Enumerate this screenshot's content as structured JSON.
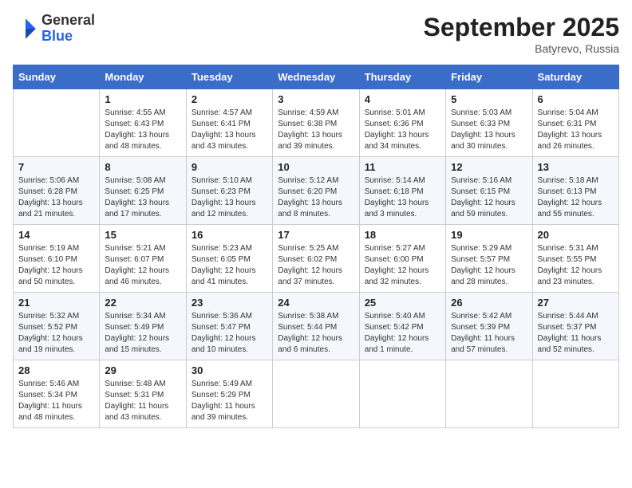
{
  "logo": {
    "general": "General",
    "blue": "Blue"
  },
  "title": "September 2025",
  "location": "Batyrevo, Russia",
  "days_of_week": [
    "Sunday",
    "Monday",
    "Tuesday",
    "Wednesday",
    "Thursday",
    "Friday",
    "Saturday"
  ],
  "weeks": [
    [
      {
        "day": "",
        "info": ""
      },
      {
        "day": "1",
        "info": "Sunrise: 4:55 AM\nSunset: 6:43 PM\nDaylight: 13 hours\nand 48 minutes."
      },
      {
        "day": "2",
        "info": "Sunrise: 4:57 AM\nSunset: 6:41 PM\nDaylight: 13 hours\nand 43 minutes."
      },
      {
        "day": "3",
        "info": "Sunrise: 4:59 AM\nSunset: 6:38 PM\nDaylight: 13 hours\nand 39 minutes."
      },
      {
        "day": "4",
        "info": "Sunrise: 5:01 AM\nSunset: 6:36 PM\nDaylight: 13 hours\nand 34 minutes."
      },
      {
        "day": "5",
        "info": "Sunrise: 5:03 AM\nSunset: 6:33 PM\nDaylight: 13 hours\nand 30 minutes."
      },
      {
        "day": "6",
        "info": "Sunrise: 5:04 AM\nSunset: 6:31 PM\nDaylight: 13 hours\nand 26 minutes."
      }
    ],
    [
      {
        "day": "7",
        "info": "Sunrise: 5:06 AM\nSunset: 6:28 PM\nDaylight: 13 hours\nand 21 minutes."
      },
      {
        "day": "8",
        "info": "Sunrise: 5:08 AM\nSunset: 6:25 PM\nDaylight: 13 hours\nand 17 minutes."
      },
      {
        "day": "9",
        "info": "Sunrise: 5:10 AM\nSunset: 6:23 PM\nDaylight: 13 hours\nand 12 minutes."
      },
      {
        "day": "10",
        "info": "Sunrise: 5:12 AM\nSunset: 6:20 PM\nDaylight: 13 hours\nand 8 minutes."
      },
      {
        "day": "11",
        "info": "Sunrise: 5:14 AM\nSunset: 6:18 PM\nDaylight: 13 hours\nand 3 minutes."
      },
      {
        "day": "12",
        "info": "Sunrise: 5:16 AM\nSunset: 6:15 PM\nDaylight: 12 hours\nand 59 minutes."
      },
      {
        "day": "13",
        "info": "Sunrise: 5:18 AM\nSunset: 6:13 PM\nDaylight: 12 hours\nand 55 minutes."
      }
    ],
    [
      {
        "day": "14",
        "info": "Sunrise: 5:19 AM\nSunset: 6:10 PM\nDaylight: 12 hours\nand 50 minutes."
      },
      {
        "day": "15",
        "info": "Sunrise: 5:21 AM\nSunset: 6:07 PM\nDaylight: 12 hours\nand 46 minutes."
      },
      {
        "day": "16",
        "info": "Sunrise: 5:23 AM\nSunset: 6:05 PM\nDaylight: 12 hours\nand 41 minutes."
      },
      {
        "day": "17",
        "info": "Sunrise: 5:25 AM\nSunset: 6:02 PM\nDaylight: 12 hours\nand 37 minutes."
      },
      {
        "day": "18",
        "info": "Sunrise: 5:27 AM\nSunset: 6:00 PM\nDaylight: 12 hours\nand 32 minutes."
      },
      {
        "day": "19",
        "info": "Sunrise: 5:29 AM\nSunset: 5:57 PM\nDaylight: 12 hours\nand 28 minutes."
      },
      {
        "day": "20",
        "info": "Sunrise: 5:31 AM\nSunset: 5:55 PM\nDaylight: 12 hours\nand 23 minutes."
      }
    ],
    [
      {
        "day": "21",
        "info": "Sunrise: 5:32 AM\nSunset: 5:52 PM\nDaylight: 12 hours\nand 19 minutes."
      },
      {
        "day": "22",
        "info": "Sunrise: 5:34 AM\nSunset: 5:49 PM\nDaylight: 12 hours\nand 15 minutes."
      },
      {
        "day": "23",
        "info": "Sunrise: 5:36 AM\nSunset: 5:47 PM\nDaylight: 12 hours\nand 10 minutes."
      },
      {
        "day": "24",
        "info": "Sunrise: 5:38 AM\nSunset: 5:44 PM\nDaylight: 12 hours\nand 6 minutes."
      },
      {
        "day": "25",
        "info": "Sunrise: 5:40 AM\nSunset: 5:42 PM\nDaylight: 12 hours\nand 1 minute."
      },
      {
        "day": "26",
        "info": "Sunrise: 5:42 AM\nSunset: 5:39 PM\nDaylight: 11 hours\nand 57 minutes."
      },
      {
        "day": "27",
        "info": "Sunrise: 5:44 AM\nSunset: 5:37 PM\nDaylight: 11 hours\nand 52 minutes."
      }
    ],
    [
      {
        "day": "28",
        "info": "Sunrise: 5:46 AM\nSunset: 5:34 PM\nDaylight: 11 hours\nand 48 minutes."
      },
      {
        "day": "29",
        "info": "Sunrise: 5:48 AM\nSunset: 5:31 PM\nDaylight: 11 hours\nand 43 minutes."
      },
      {
        "day": "30",
        "info": "Sunrise: 5:49 AM\nSunset: 5:29 PM\nDaylight: 11 hours\nand 39 minutes."
      },
      {
        "day": "",
        "info": ""
      },
      {
        "day": "",
        "info": ""
      },
      {
        "day": "",
        "info": ""
      },
      {
        "day": "",
        "info": ""
      }
    ]
  ]
}
